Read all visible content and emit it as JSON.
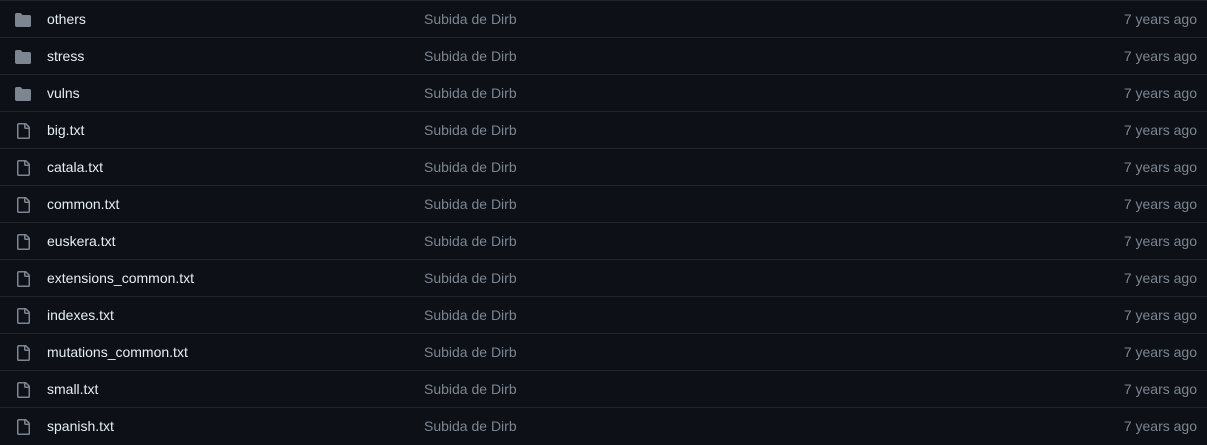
{
  "files": [
    {
      "type": "folder",
      "icon": "folder-icon",
      "name": "others",
      "commit": "Subida de Dirb",
      "age": "7 years ago"
    },
    {
      "type": "folder",
      "icon": "folder-icon",
      "name": "stress",
      "commit": "Subida de Dirb",
      "age": "7 years ago"
    },
    {
      "type": "folder",
      "icon": "folder-icon",
      "name": "vulns",
      "commit": "Subida de Dirb",
      "age": "7 years ago"
    },
    {
      "type": "file",
      "icon": "file-icon",
      "name": "big.txt",
      "commit": "Subida de Dirb",
      "age": "7 years ago"
    },
    {
      "type": "file",
      "icon": "file-icon",
      "name": "catala.txt",
      "commit": "Subida de Dirb",
      "age": "7 years ago"
    },
    {
      "type": "file",
      "icon": "file-icon",
      "name": "common.txt",
      "commit": "Subida de Dirb",
      "age": "7 years ago"
    },
    {
      "type": "file",
      "icon": "file-icon",
      "name": "euskera.txt",
      "commit": "Subida de Dirb",
      "age": "7 years ago"
    },
    {
      "type": "file",
      "icon": "file-icon",
      "name": "extensions_common.txt",
      "commit": "Subida de Dirb",
      "age": "7 years ago"
    },
    {
      "type": "file",
      "icon": "file-icon",
      "name": "indexes.txt",
      "commit": "Subida de Dirb",
      "age": "7 years ago"
    },
    {
      "type": "file",
      "icon": "file-icon",
      "name": "mutations_common.txt",
      "commit": "Subida de Dirb",
      "age": "7 years ago"
    },
    {
      "type": "file",
      "icon": "file-icon",
      "name": "small.txt",
      "commit": "Subida de Dirb",
      "age": "7 years ago"
    },
    {
      "type": "file",
      "icon": "file-icon",
      "name": "spanish.txt",
      "commit": "Subida de Dirb",
      "age": "7 years ago"
    }
  ],
  "colors": {
    "background": "#0d1117",
    "border": "#21262d",
    "text": "#e6edf3",
    "muted": "#7d8590",
    "icon": "#7d8590"
  }
}
